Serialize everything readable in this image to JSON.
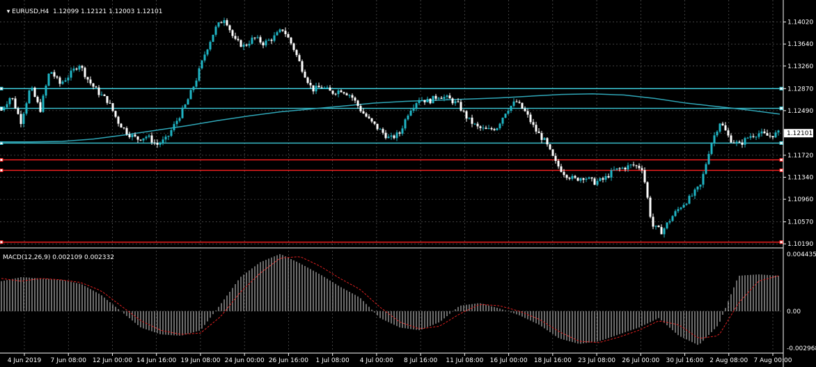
{
  "header": {
    "symbol_icon": "triangle-down-icon",
    "text": "EURUSD,H4  1.12099 1.12121 1.12003 1.12101"
  },
  "macd": {
    "text": "MACD(12,26,9) 0.002109 0.002332",
    "scale_top": "0.004435",
    "scale_zero": "0.00",
    "scale_bottom": "-0.002968"
  },
  "colors": {
    "background": "#000000",
    "grid": "#6a6a6a",
    "candle_up": "#1fb5c4",
    "candle_down": "#ffffff",
    "ma_line": "#2fa7b8",
    "hline_cyan": "#3cc8d6",
    "hline_red": "#ff2020",
    "macd_hist": "#d8d8d8",
    "macd_signal": "#e02020"
  },
  "chart_data": {
    "type": "candlestick",
    "symbol": "EURUSD",
    "timeframe": "H4",
    "ohlc_current": {
      "open": 1.12099,
      "high": 1.12121,
      "low": 1.12003,
      "close": 1.12101
    },
    "current_price_label": "1.12101",
    "ylim": [
      1.1012,
      1.144
    ],
    "y_ticks": [
      "1.14020",
      "1.13640",
      "1.13260",
      "1.12870",
      "1.12490",
      "1.12101",
      "1.11720",
      "1.11340",
      "1.10960",
      "1.10570",
      "1.10190"
    ],
    "y_tick_values": [
      1.1402,
      1.1364,
      1.1326,
      1.1287,
      1.1249,
      1.12101,
      1.1172,
      1.1134,
      1.1096,
      1.1057,
      1.1019
    ],
    "x_ticks": [
      "4 Jun 2019",
      "7 Jun 08:00",
      "12 Jun 00:00",
      "14 Jun 16:00",
      "19 Jun 08:00",
      "24 Jun 00:00",
      "26 Jun 16:00",
      "1 Jul 08:00",
      "4 Jul 00:00",
      "8 Jul 16:00",
      "11 Jul 08:00",
      "16 Jul 00:00",
      "18 Jul 16:00",
      "23 Jul 08:00",
      "26 Jul 00:00",
      "30 Jul 16:00",
      "2 Aug 08:00",
      "7 Aug 00:00"
    ],
    "horizontal_lines": [
      {
        "price": 1.1287,
        "color": "cyan"
      },
      {
        "price": 1.1253,
        "color": "cyan"
      },
      {
        "price": 1.1193,
        "color": "cyan"
      },
      {
        "price": 1.1164,
        "color": "red"
      },
      {
        "price": 1.1146,
        "color": "red"
      },
      {
        "price": 1.1022,
        "color": "red"
      }
    ],
    "close_path": [
      1.125,
      1.1275,
      1.123,
      1.129,
      1.125,
      1.132,
      1.1295,
      1.131,
      1.133,
      1.13,
      1.128,
      1.1265,
      1.123,
      1.121,
      1.12,
      1.1205,
      1.119,
      1.12,
      1.123,
      1.126,
      1.13,
      1.135,
      1.139,
      1.141,
      1.137,
      1.136,
      1.1375,
      1.1365,
      1.1375,
      1.139,
      1.136,
      1.132,
      1.1285,
      1.129,
      1.128,
      1.1285,
      1.1275,
      1.125,
      1.123,
      1.1215,
      1.12,
      1.121,
      1.125,
      1.127,
      1.1265,
      1.1275,
      1.127,
      1.126,
      1.1235,
      1.122,
      1.1215,
      1.122,
      1.125,
      1.1265,
      1.1245,
      1.1215,
      1.1195,
      1.116,
      1.114,
      1.113,
      1.1135,
      1.1125,
      1.113,
      1.1145,
      1.115,
      1.1155,
      1.115,
      1.105,
      1.104,
      1.1065,
      1.1085,
      1.11,
      1.112,
      1.119,
      1.123,
      1.12,
      1.119,
      1.1205,
      1.121,
      1.1205,
      1.121
    ],
    "ma_path": [
      1.1195,
      1.1195,
      1.1196,
      1.12,
      1.1207,
      1.1215,
      1.1223,
      1.1232,
      1.124,
      1.1247,
      1.1252,
      1.1257,
      1.1262,
      1.1265,
      1.1267,
      1.1269,
      1.1271,
      1.1274,
      1.1277,
      1.1278,
      1.1276,
      1.127,
      1.1262,
      1.1256,
      1.125,
      1.1243
    ],
    "macd": {
      "ylim": [
        -0.002968,
        0.004435
      ],
      "histogram": [
        0.0022,
        0.0025,
        0.0024,
        0.0023,
        0.002,
        0.0012,
        0.0,
        -0.0012,
        -0.0017,
        -0.0018,
        -0.0014,
        0.0005,
        0.0025,
        0.0036,
        0.0042,
        0.0035,
        0.0027,
        0.0018,
        0.001,
        -0.0005,
        -0.0012,
        -0.0014,
        -0.0008,
        0.0004,
        0.0006,
        0.0002,
        -0.0003,
        -0.001,
        -0.002,
        -0.0024,
        -0.0022,
        -0.0017,
        -0.0012,
        -0.0005,
        -0.0018,
        -0.0025,
        -0.001,
        0.0026,
        0.0027,
        0.0026
      ],
      "signal": [
        0.0024,
        0.0022,
        0.0024,
        0.0023,
        0.0021,
        0.0015,
        0.0004,
        -0.0007,
        -0.0014,
        -0.0017,
        -0.0016,
        -0.0004,
        0.0014,
        0.0028,
        0.0039,
        0.004,
        0.0033,
        0.0024,
        0.0016,
        0.0003,
        -0.0008,
        -0.0013,
        -0.0011,
        -0.0002,
        0.0005,
        0.0004,
        0.0,
        -0.0006,
        -0.0015,
        -0.0022,
        -0.0023,
        -0.0019,
        -0.0014,
        -0.0007,
        -0.001,
        -0.002,
        -0.0018,
        0.0006,
        0.0022,
        0.0026
      ]
    }
  }
}
